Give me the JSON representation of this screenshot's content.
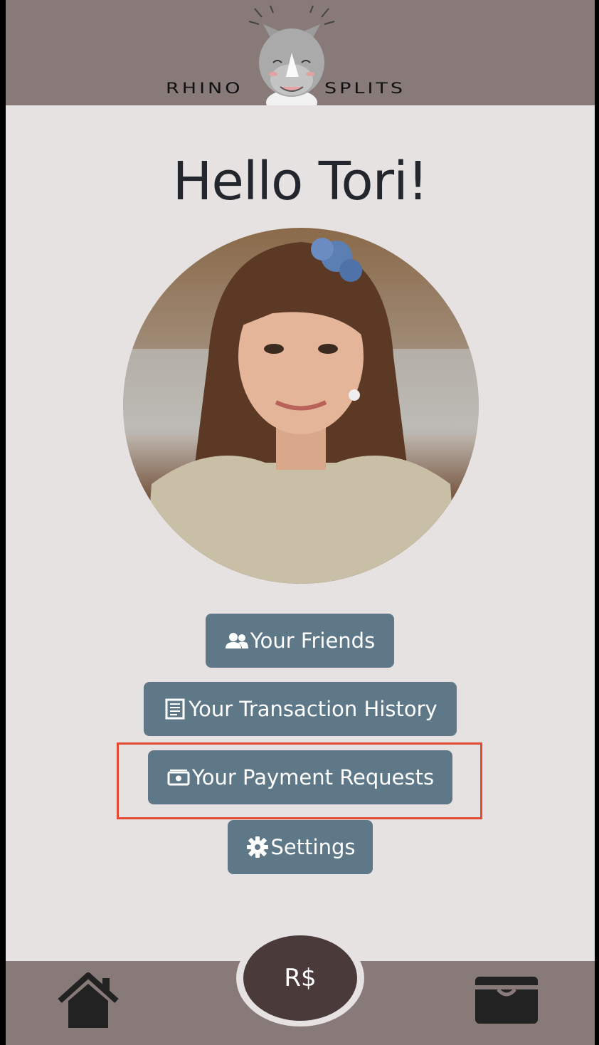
{
  "header": {
    "logo_left": "RHINO",
    "logo_right": "SPLITS"
  },
  "main": {
    "greeting": "Hello Tori!",
    "buttons": {
      "friends": "Your Friends",
      "history": "Your Transaction History",
      "payments": "Your Payment Requests",
      "settings": "Settings"
    }
  },
  "footer": {
    "currency_label": "R$"
  },
  "colors": {
    "header_bg": "#877a79",
    "page_bg": "#e6e2e1",
    "button_bg": "#5f7888",
    "highlight": "#e24a33",
    "currency_bg": "#4a3a3a"
  },
  "icons": {
    "friends": "users-icon",
    "history": "receipt-icon",
    "payments": "cash-icon",
    "settings": "gear-icon",
    "home": "home-icon",
    "wallet": "wallet-icon"
  }
}
